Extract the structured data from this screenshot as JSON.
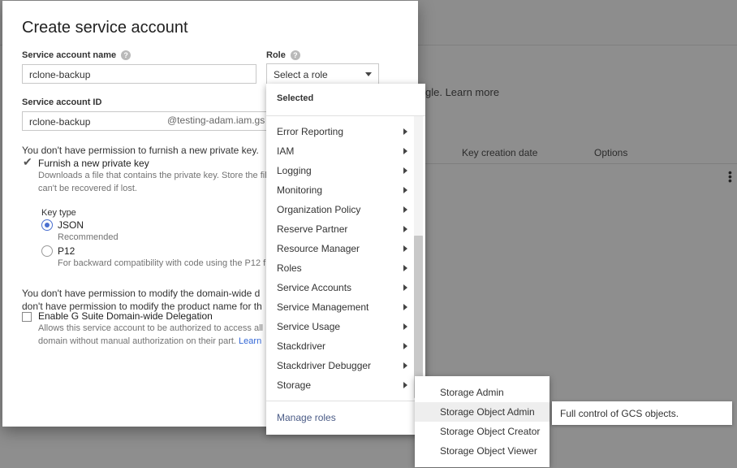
{
  "background": {
    "learn_more_text": "gle. Learn more",
    "columns": [
      "Key creation date",
      "Options"
    ],
    "kebab": "more-vert-icon"
  },
  "dialog": {
    "title": "Create service account",
    "service_account_name_label": "Service account name",
    "service_account_name_value": "rclone-backup",
    "role_label": "Role",
    "role_select_value": "Select a role",
    "service_account_id_label": "Service account ID",
    "service_account_id_value": "rclone-backup",
    "service_account_id_suffix": "@testing-adam.iam.gs",
    "key_permission_msg": "You don't have permission to furnish a new private key.",
    "furnish_key_label": "Furnish a new private key",
    "furnish_key_checked": true,
    "furnish_key_desc_line1": "Downloads a file that contains the private key. Store the fil",
    "furnish_key_desc_line2": "can't be recovered if lost.",
    "key_type_label": "Key type",
    "key_types": [
      {
        "label": "JSON",
        "desc": "Recommended",
        "selected": true
      },
      {
        "label": "P12",
        "desc": "For backward compatibility with code using the P12 f",
        "selected": false
      }
    ],
    "delegation_permission_line1": "You don't have permission to modify the domain-wide d",
    "delegation_permission_line2": "don't have permission to modify the product name for th",
    "delegation_label": "Enable G Suite Domain-wide Delegation",
    "delegation_checked": false,
    "delegation_desc_line1": "Allows this service account to be authorized to access all",
    "delegation_desc_line2": "domain without manual authorization on their part.",
    "delegation_learn": "Learn"
  },
  "role_menu": {
    "selected_header": "Selected",
    "items": [
      "Error Reporting",
      "IAM",
      "Logging",
      "Monitoring",
      "Organization Policy",
      "Reserve Partner",
      "Resource Manager",
      "Roles",
      "Service Accounts",
      "Service Management",
      "Service Usage",
      "Stackdriver",
      "Stackdriver Debugger",
      "Storage"
    ],
    "manage_roles": "Manage roles"
  },
  "storage_submenu": {
    "items": [
      "Storage Admin",
      "Storage Object Admin",
      "Storage Object Creator",
      "Storage Object Viewer"
    ],
    "hovered_index": 1
  },
  "tooltip": {
    "text": "Full control of GCS objects."
  }
}
